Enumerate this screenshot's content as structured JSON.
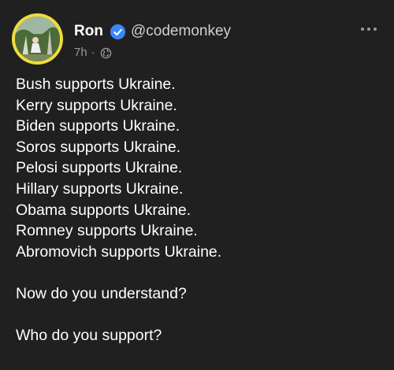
{
  "author": {
    "name": "Ron",
    "handle": "@codemonkey",
    "verified": true
  },
  "meta": {
    "time": "7h",
    "separator": "·",
    "visibility_icon": "globe-icon"
  },
  "menu_icon": "more-horizontal-icon",
  "post": {
    "lines": [
      "Bush supports Ukraine.",
      "Kerry supports Ukraine.",
      "Biden supports Ukraine.",
      "Soros supports Ukraine.",
      "Pelosi supports Ukraine.",
      "Hillary supports Ukraine.",
      "Obama supports Ukraine.",
      "Romney supports Ukraine.",
      "Abromovich supports Ukraine."
    ],
    "question_1": "Now do you understand?",
    "question_2": "Who do you support?"
  },
  "colors": {
    "background": "#202020",
    "avatar_ring": "#f0dc3c",
    "verified_badge": "#3b88f5",
    "muted_text": "#9a9a9a"
  }
}
